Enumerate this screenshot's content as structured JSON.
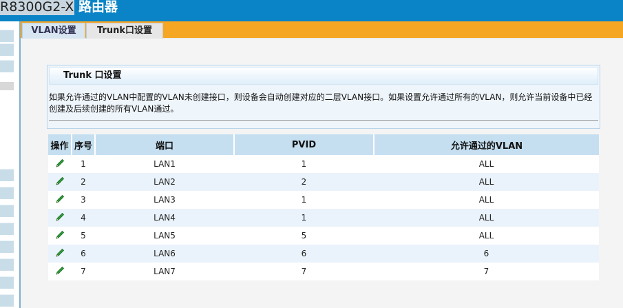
{
  "header": {
    "model": "R8300G2-X",
    "title": "路由器"
  },
  "tabs": [
    {
      "label": "VLAN设置"
    },
    {
      "label": "Trunk口设置"
    }
  ],
  "section": {
    "title": "Trunk 口设置",
    "description": "如果允许通过的VLAN中配置的VLAN未创建接口，则设备会自动创建对应的二层VLAN接口。如果设置允许通过所有的VLAN，则允许当前设备中已经创建及后续创建的所有VLAN通过。"
  },
  "table": {
    "columns": [
      "操作",
      "序号",
      "端口",
      "PVID",
      "允许通过的VLAN"
    ],
    "rows": [
      {
        "index": "1",
        "port": "LAN1",
        "pvid": "1",
        "allowed": "ALL"
      },
      {
        "index": "2",
        "port": "LAN2",
        "pvid": "2",
        "allowed": "ALL"
      },
      {
        "index": "3",
        "port": "LAN3",
        "pvid": "1",
        "allowed": "ALL"
      },
      {
        "index": "4",
        "port": "LAN4",
        "pvid": "1",
        "allowed": "ALL"
      },
      {
        "index": "5",
        "port": "LAN5",
        "pvid": "5",
        "allowed": "ALL"
      },
      {
        "index": "6",
        "port": "LAN6",
        "pvid": "6",
        "allowed": "6"
      },
      {
        "index": "7",
        "port": "LAN7",
        "pvid": "7",
        "allowed": "7"
      }
    ]
  },
  "icons": {
    "edit": "pencil-icon"
  },
  "colors": {
    "header": "#0a84c6",
    "tab_bar": "#f5a623",
    "table_header": "#c5dff0",
    "row_alt": "#eaf3fb",
    "pencil": "#2e9b3a"
  }
}
